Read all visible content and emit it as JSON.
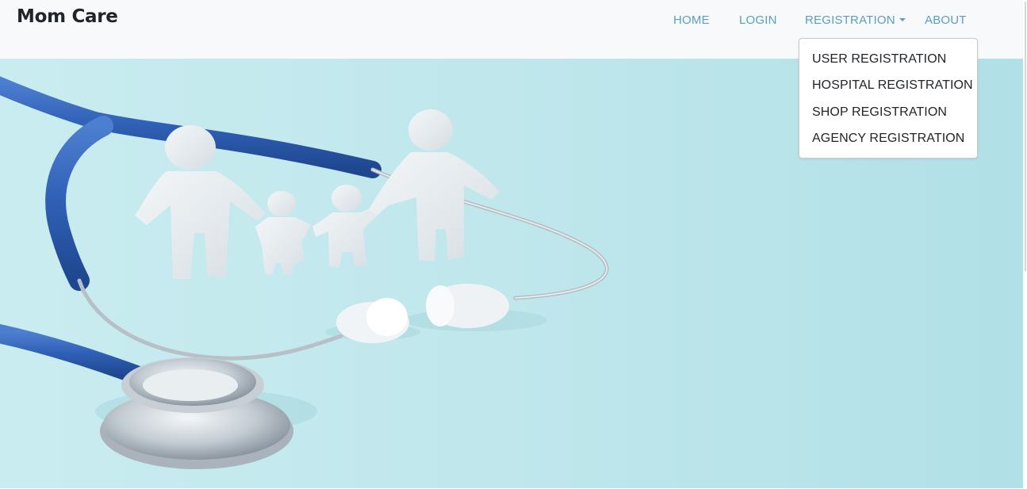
{
  "navbar": {
    "brand": "Mom Care",
    "links": {
      "home": "HOME",
      "login": "LOGIN",
      "registration": "REGISTRATION",
      "about": "ABOUT"
    }
  },
  "registration_dropdown": {
    "items": [
      "USER REGISTRATION",
      "HOSPITAL REGISTRATION",
      "SHOP REGISTRATION",
      "AGENCY REGISTRATION"
    ]
  },
  "hero": {
    "icon": "stethoscope-family-illustration"
  },
  "colors": {
    "nav_link": "#5a9fc0",
    "navbar_bg": "#f8f9fa",
    "hero_bg": "#bfe7ec",
    "tube_blue": "#2f5fb5"
  }
}
